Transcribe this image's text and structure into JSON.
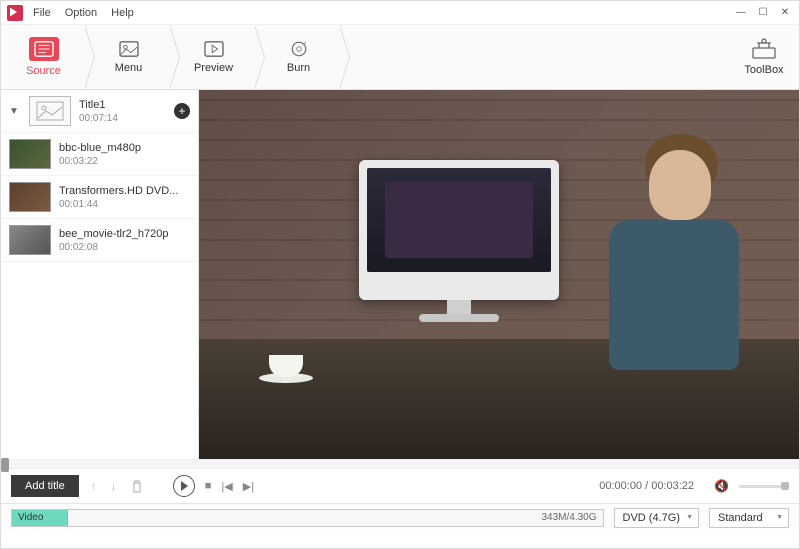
{
  "menubar": {
    "file": "File",
    "option": "Option",
    "help": "Help"
  },
  "toolbar": {
    "source": "Source",
    "menu": "Menu",
    "preview": "Preview",
    "burn": "Burn",
    "toolbox": "ToolBox"
  },
  "titles": {
    "header": {
      "name": "Title1",
      "duration": "00:07:14"
    },
    "items": [
      {
        "name": "bbc-blue_m480p",
        "duration": "00:03:22"
      },
      {
        "name": "Transformers.HD DVD...",
        "duration": "00:01:44"
      },
      {
        "name": "bee_movie-tlr2_h720p",
        "duration": "00:02:08"
      }
    ]
  },
  "controls": {
    "add_title": "Add title",
    "time": "00:00:00 / 00:03:22"
  },
  "bottom": {
    "video_label": "Video",
    "size": "343M/4.30G",
    "disc": "DVD (4.7G)",
    "quality": "Standard"
  }
}
